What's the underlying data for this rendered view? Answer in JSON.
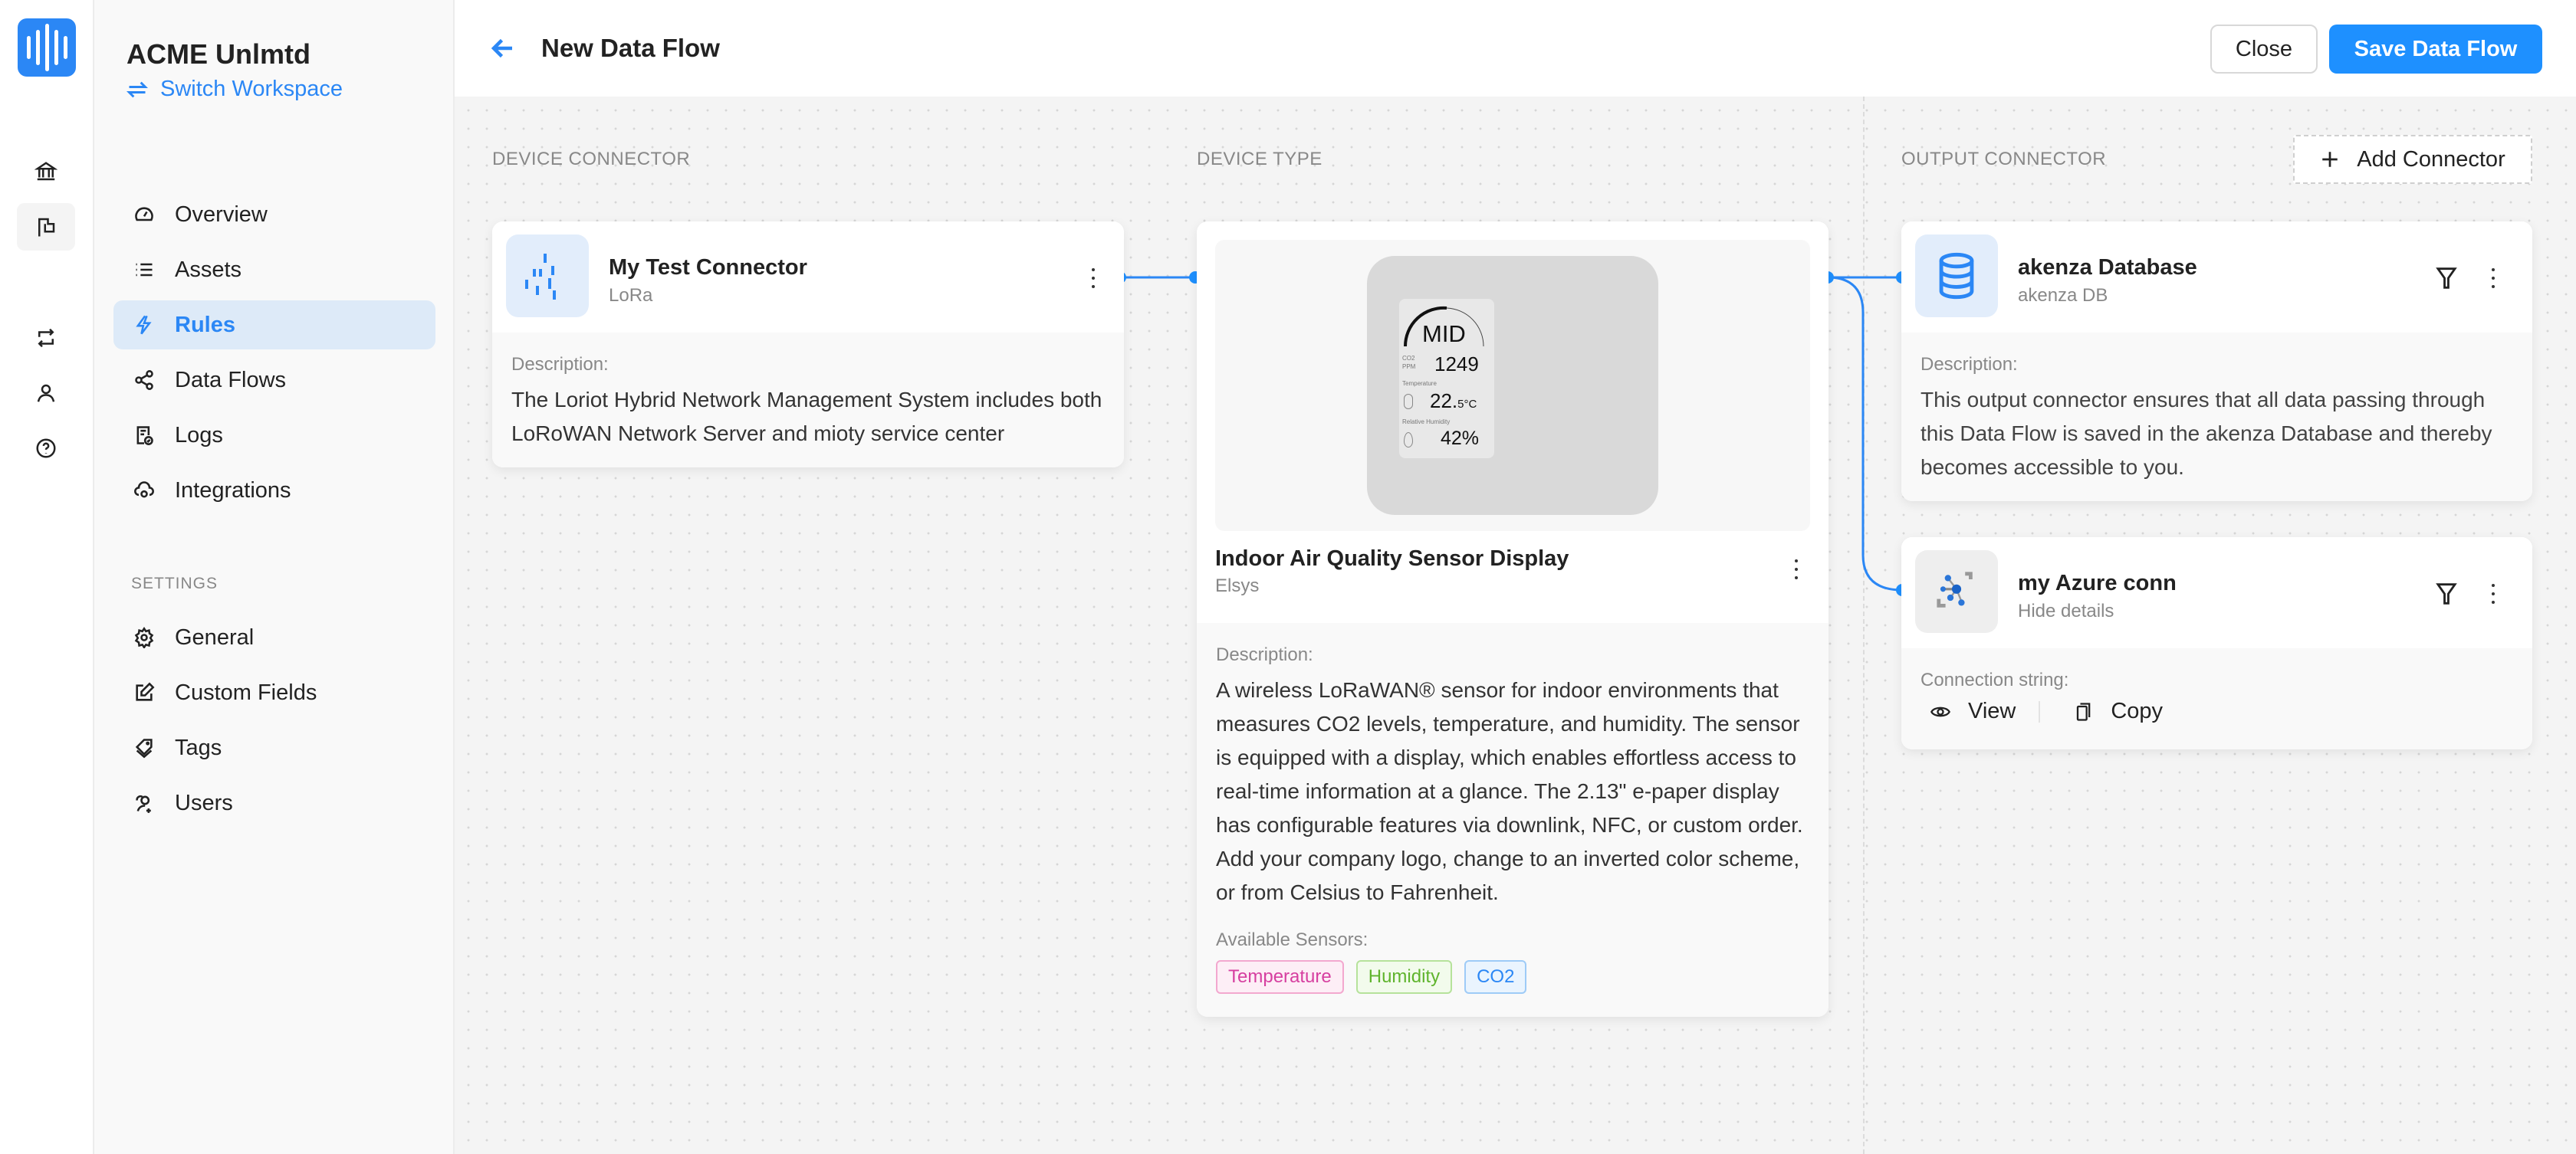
{
  "workspace": {
    "name": "ACME Unlmtd",
    "switch_label": "Switch Workspace"
  },
  "rail": {
    "items": [
      {
        "icon": "bank-icon"
      },
      {
        "icon": "flag-icon",
        "active": true
      },
      {
        "icon": "repeat-icon"
      },
      {
        "icon": "user-icon"
      },
      {
        "icon": "help-icon"
      }
    ]
  },
  "sidebar": {
    "items": [
      {
        "label": "Overview",
        "icon": "dashboard-icon"
      },
      {
        "label": "Assets",
        "icon": "list-icon"
      },
      {
        "label": "Rules",
        "icon": "lightning-icon",
        "active": true
      },
      {
        "label": "Data Flows",
        "icon": "share-icon"
      },
      {
        "label": "Logs",
        "icon": "log-icon"
      },
      {
        "label": "Integrations",
        "icon": "cloud-sync-icon"
      }
    ],
    "settings_label": "SETTINGS",
    "settings_items": [
      {
        "label": "General",
        "icon": "gear-icon"
      },
      {
        "label": "Custom Fields",
        "icon": "edit-icon"
      },
      {
        "label": "Tags",
        "icon": "tag-icon"
      },
      {
        "label": "Users",
        "icon": "users-icon"
      }
    ]
  },
  "header": {
    "title": "New Data Flow",
    "close_label": "Close",
    "save_label": "Save Data Flow"
  },
  "canvas": {
    "columns": {
      "device_connector": "DEVICE CONNECTOR",
      "device_type": "DEVICE TYPE",
      "output_connector": "OUTPUT CONNECTOR"
    },
    "add_connector_label": "Add Connector",
    "device_connector": {
      "title": "My Test Connector",
      "subtitle": "LoRa",
      "description_label": "Description:",
      "description": "The Loriot Hybrid Network Management System includes both LoRoWAN Network Server and mioty service center"
    },
    "device_type": {
      "title": "Indoor Air Quality Sensor Display",
      "subtitle": "Elsys",
      "display": {
        "level": "MID",
        "co2_label_1": "CO2",
        "co2_label_2": "PPM",
        "co2_value": "1249",
        "temp_label": "Temperature",
        "temp_value": "22.",
        "temp_decimal": "5°C",
        "humidity_label": "Relative Humidity",
        "humidity_value": "42%"
      },
      "description_label": "Description:",
      "description": "A wireless LoRaWAN® sensor for indoor environments that measures CO2 levels, temperature, and humidity. The sensor is equipped with a display, which enables effortless access to real-time information at a glance. The 2.13\" e-paper display has configurable features via downlink, NFC, or custom order. Add your company logo, change to an inverted color scheme, or from Celsius to Fahrenheit.",
      "sensors_label": "Available Sensors:",
      "sensors": [
        {
          "label": "Temperature",
          "color": "#d63fa0"
        },
        {
          "label": "Humidity",
          "color": "#5fb42d"
        },
        {
          "label": "CO2",
          "color": "#2b87f5"
        }
      ]
    },
    "outputs": [
      {
        "title": "akenza Database",
        "subtitle": "akenza DB",
        "description_label": "Description:",
        "description": "This output connector ensures that all data passing through this Data Flow is saved in the akenza Database and thereby becomes accessible to you."
      },
      {
        "title": "my Azure conn",
        "subtitle": "Hide details",
        "connection_label": "Connection string:",
        "view_label": "View",
        "copy_label": "Copy"
      }
    ]
  },
  "colors": {
    "accent": "#1e90ff",
    "link": "#2b87f5",
    "active_nav_bg": "#ddeaf8"
  }
}
